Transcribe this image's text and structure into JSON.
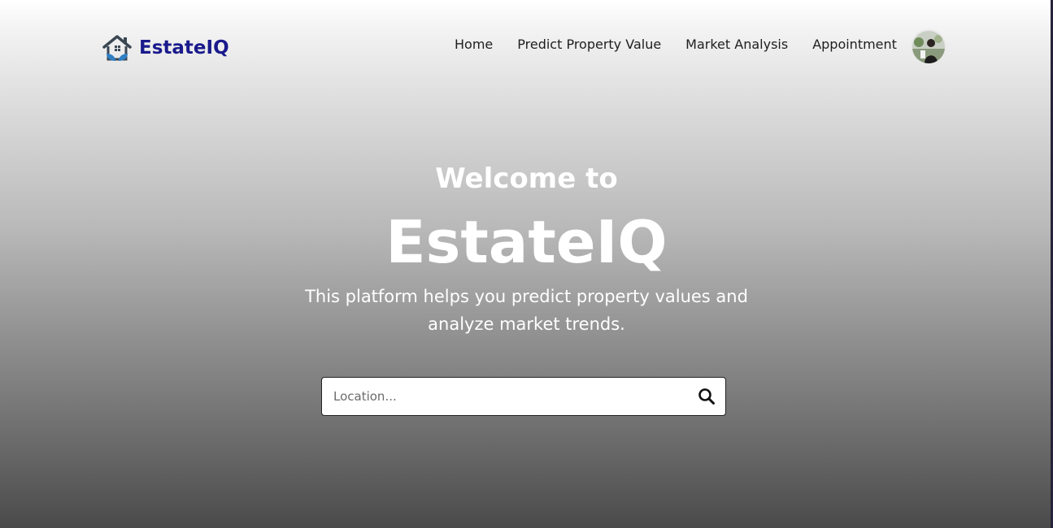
{
  "brand": {
    "name": "EstateIQ",
    "color": "#1a1a8c"
  },
  "nav": {
    "links": [
      {
        "label": "Home"
      },
      {
        "label": "Predict Property Value"
      },
      {
        "label": "Market Analysis"
      },
      {
        "label": "Appointment"
      }
    ],
    "avatar_icon": "user-avatar-icon"
  },
  "hero": {
    "welcome": "Welcome to",
    "title": "EstateIQ",
    "tagline": "This platform helps you predict property values and analyze market trends."
  },
  "search": {
    "placeholder": "Location...",
    "value": "",
    "icon": "search-icon"
  },
  "colors": {
    "hero_text": "#ffffff",
    "nav_text": "#1e1e1e",
    "logo_blue": "#2f7fc4",
    "logo_dark": "#3a4652"
  }
}
